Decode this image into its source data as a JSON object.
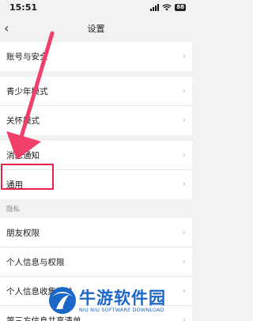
{
  "status_bar": {
    "time": "15:51",
    "battery": "88"
  },
  "header": {
    "title": "设置",
    "back_icon": "chevron-left-icon"
  },
  "groups": [
    [
      "账号与安全"
    ],
    [
      "青少年模式",
      "关怀模式"
    ],
    [
      "消息通知",
      "通用"
    ]
  ],
  "privacy": {
    "header": "隐私",
    "items": [
      "朋友权限",
      "个人信息与权限",
      "个人信息收集清单",
      "第三方信息共享清单"
    ]
  },
  "watermark": {
    "title": "牛游软件园",
    "subtitle": "NIU NIU SOFTWARE DOWNLOAD"
  },
  "colors": {
    "annotation": "#e8204a",
    "watermark": "#1b66c9"
  }
}
